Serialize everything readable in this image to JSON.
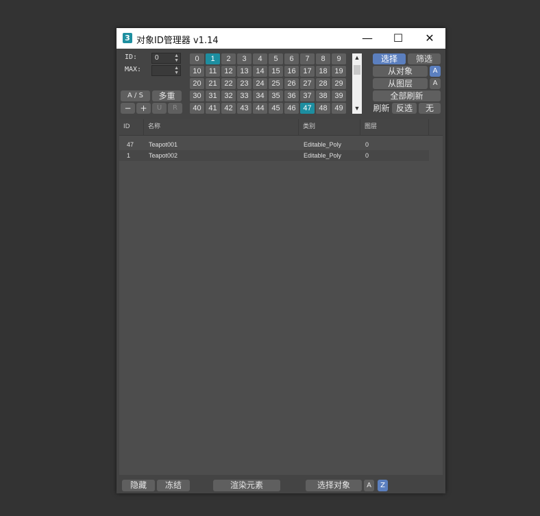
{
  "window": {
    "icon_text": "3",
    "title": "对象ID管理器  v1.14",
    "minimize": "—",
    "maximize": "☐",
    "close": "✕"
  },
  "id_panel": {
    "id_label": "ID:",
    "id_value": "0",
    "max_label": "MAX:",
    "max_value": "",
    "as_label": "A / S",
    "multi_label": "多重",
    "minus_label": "−",
    "plus_label": "+",
    "u_label": "U",
    "r_label": "R"
  },
  "grid": {
    "numbers": [
      "0",
      "1",
      "2",
      "3",
      "4",
      "5",
      "6",
      "7",
      "8",
      "9",
      "10",
      "11",
      "12",
      "13",
      "14",
      "15",
      "16",
      "17",
      "18",
      "19",
      "20",
      "21",
      "22",
      "23",
      "24",
      "25",
      "26",
      "27",
      "28",
      "29",
      "30",
      "31",
      "32",
      "33",
      "34",
      "35",
      "36",
      "37",
      "38",
      "39",
      "40",
      "41",
      "42",
      "43",
      "44",
      "45",
      "46",
      "47",
      "48",
      "49"
    ],
    "selected": [
      "1",
      "47"
    ]
  },
  "right_panel": {
    "select": "选择",
    "filter": "筛选",
    "from_object": "从对象",
    "from_object_flag": "A",
    "from_layer": "从图层",
    "from_layer_flag": "A",
    "refresh_all": "全部刷新",
    "refresh": "刷新",
    "invert": "反选",
    "none": "无"
  },
  "table": {
    "columns": [
      "ID",
      "名称",
      "类别",
      "图层"
    ],
    "rows": [
      {
        "id": "47",
        "name": "Teapot001",
        "category": "Editable_Poly",
        "layer": "0"
      },
      {
        "id": "1",
        "name": "Teapot002",
        "category": "Editable_Poly",
        "layer": "0"
      }
    ]
  },
  "bottom": {
    "hide": "隐藏",
    "freeze": "冻结",
    "render_elements": "渲染元素",
    "select_objects": "选择对象",
    "flag_a": "A",
    "flag_z": "Z"
  },
  "colors": {
    "accent_teal": "#1d8ea0",
    "accent_blue": "#5b7fbf",
    "panel": "#444444",
    "button": "#5f5f5f"
  }
}
